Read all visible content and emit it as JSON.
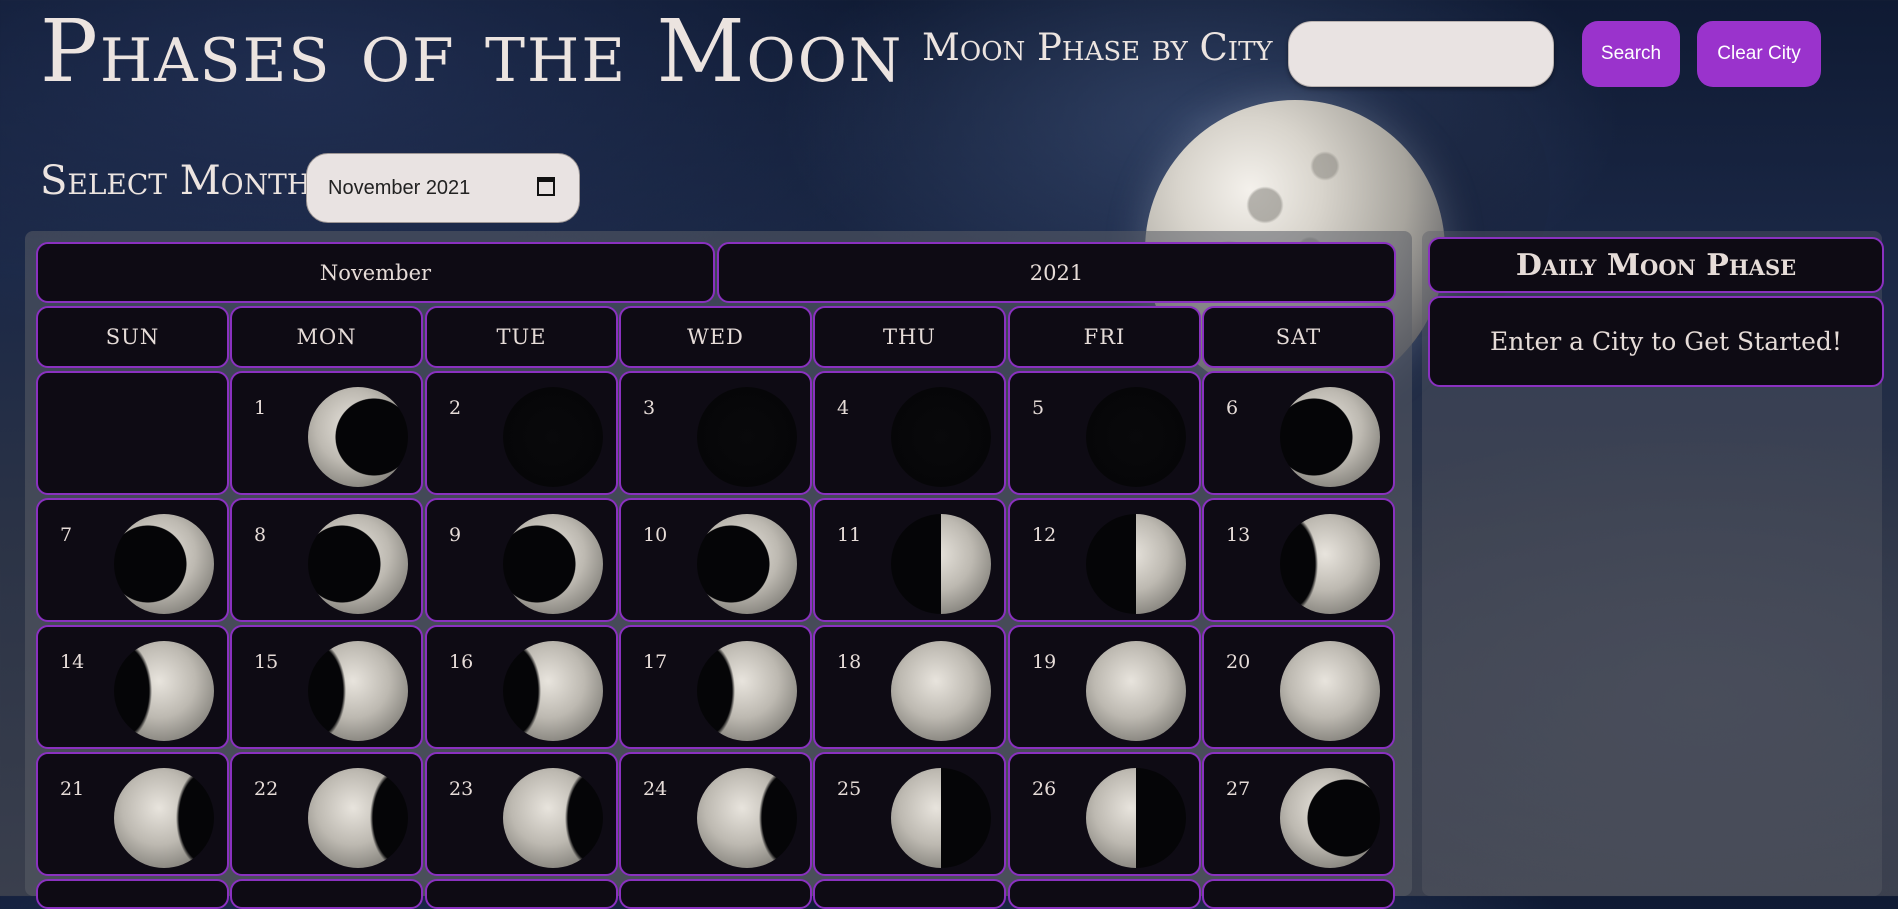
{
  "header": {
    "title": "Phases of the Moon",
    "city_label": "Moon Phase by City",
    "city_input_value": "",
    "search_label": "Search",
    "clear_label": "Clear City"
  },
  "month_picker": {
    "label": "Select Month:",
    "value": "November 2021",
    "icon": "calendar-icon"
  },
  "calendar": {
    "month": "November",
    "year": "2021",
    "weekdays": [
      "SUN",
      "MON",
      "TUE",
      "WED",
      "THU",
      "FRI",
      "SAT"
    ],
    "weeks": [
      [
        {
          "day": "",
          "phase": ""
        },
        {
          "day": "1",
          "phase": "waning-crescent"
        },
        {
          "day": "2",
          "phase": "new"
        },
        {
          "day": "3",
          "phase": "new"
        },
        {
          "day": "4",
          "phase": "new"
        },
        {
          "day": "5",
          "phase": "new"
        },
        {
          "day": "6",
          "phase": "waxing-crescent"
        }
      ],
      [
        {
          "day": "7",
          "phase": "waxing-crescent"
        },
        {
          "day": "8",
          "phase": "waxing-crescent"
        },
        {
          "day": "9",
          "phase": "waxing-crescent"
        },
        {
          "day": "10",
          "phase": "waxing-crescent"
        },
        {
          "day": "11",
          "phase": "first-quarter"
        },
        {
          "day": "12",
          "phase": "first-quarter"
        },
        {
          "day": "13",
          "phase": "waxing-gibbous"
        }
      ],
      [
        {
          "day": "14",
          "phase": "waxing-gibbous"
        },
        {
          "day": "15",
          "phase": "waxing-gibbous"
        },
        {
          "day": "16",
          "phase": "waxing-gibbous"
        },
        {
          "day": "17",
          "phase": "waxing-gibbous"
        },
        {
          "day": "18",
          "phase": "full"
        },
        {
          "day": "19",
          "phase": "full"
        },
        {
          "day": "20",
          "phase": "full"
        }
      ],
      [
        {
          "day": "21",
          "phase": "waning-gibbous"
        },
        {
          "day": "22",
          "phase": "waning-gibbous"
        },
        {
          "day": "23",
          "phase": "waning-gibbous"
        },
        {
          "day": "24",
          "phase": "waning-gibbous"
        },
        {
          "day": "25",
          "phase": "last-quarter"
        },
        {
          "day": "26",
          "phase": "last-quarter"
        },
        {
          "day": "27",
          "phase": "waning-crescent"
        }
      ]
    ]
  },
  "side": {
    "title": "Daily Moon Phase",
    "message": "Enter a City to Get Started!"
  },
  "colors": {
    "accent": "#9a33cc",
    "cell_bg": "#0e0b14",
    "cell_border": "#8a31c0",
    "text": "#ece4e0"
  }
}
